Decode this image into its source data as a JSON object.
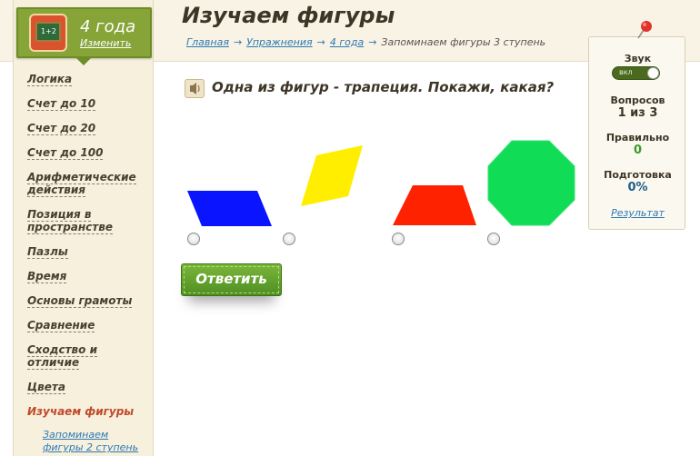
{
  "sidebar": {
    "age_title": "4 года",
    "change_label": "Изменить",
    "age_icon_text": "1+2",
    "items": [
      {
        "label": "Логика"
      },
      {
        "label": "Счет до 10"
      },
      {
        "label": "Счет до 20"
      },
      {
        "label": "Счет до 100"
      },
      {
        "label": "Арифметические действия"
      },
      {
        "label": "Позиция в пространстве"
      },
      {
        "label": "Пазлы"
      },
      {
        "label": "Время"
      },
      {
        "label": "Основы грамоты"
      },
      {
        "label": "Сравнение"
      },
      {
        "label": "Сходство и отличие"
      },
      {
        "label": "Цвета"
      },
      {
        "label": "Изучаем фигуры",
        "active": true
      }
    ],
    "subitem": "Запоминаем фигуры 2 ступень"
  },
  "header": {
    "title": "Изучаем фигуры",
    "breadcrumb": {
      "home": "Главная",
      "exercises": "Упражнения",
      "age": "4 года",
      "current": "Запоминаем фигуры 3 ступень",
      "separator": "→"
    }
  },
  "question": {
    "text": "Одна из фигур - трапеция. Покажи, какая?",
    "shapes": [
      {
        "name": "parallelogram",
        "color": "#0a14ff"
      },
      {
        "name": "rhombus",
        "color": "#ffee00"
      },
      {
        "name": "trapezoid",
        "color": "#ff2200"
      },
      {
        "name": "octagon",
        "color": "#10dd55"
      }
    ],
    "answer_button": "Ответить"
  },
  "stats": {
    "sound_label": "Звук",
    "sound_toggle": "вкл",
    "questions_label": "Вопросов",
    "questions_value": "1 из 3",
    "correct_label": "Правильно",
    "correct_value": "0",
    "progress_label": "Подготовка",
    "progress_value": "0%",
    "result_link": "Результат"
  },
  "colors": {
    "accent_green": "#86a437",
    "link_blue": "#2e79b5",
    "active_item": "#c0492a",
    "correct_green": "#3c9a2c",
    "progress_blue": "#1f5d8a"
  }
}
